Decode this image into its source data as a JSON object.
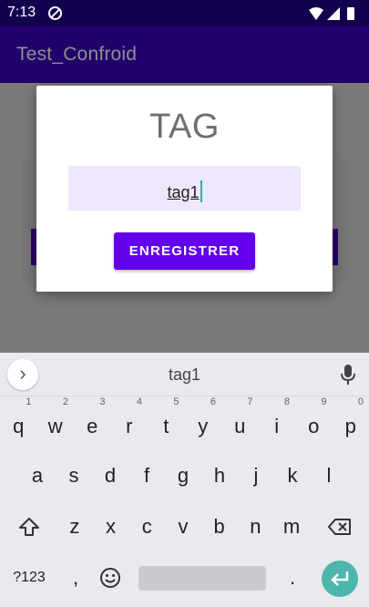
{
  "status_bar": {
    "time": "7:13"
  },
  "app_bar": {
    "title": "Test_Confroid"
  },
  "dialog": {
    "title": "TAG",
    "tag_value": "tag1",
    "save_label": "ENREGISTRER"
  },
  "keyboard": {
    "suggestion": "tag1",
    "row1": [
      {
        "k": "q",
        "h": "1"
      },
      {
        "k": "w",
        "h": "2"
      },
      {
        "k": "e",
        "h": "3"
      },
      {
        "k": "r",
        "h": "4"
      },
      {
        "k": "t",
        "h": "5"
      },
      {
        "k": "y",
        "h": "6"
      },
      {
        "k": "u",
        "h": "7"
      },
      {
        "k": "i",
        "h": "8"
      },
      {
        "k": "o",
        "h": "9"
      },
      {
        "k": "p",
        "h": "0"
      }
    ],
    "row2": [
      "a",
      "s",
      "d",
      "f",
      "g",
      "h",
      "j",
      "k",
      "l"
    ],
    "row3": [
      "z",
      "x",
      "c",
      "v",
      "b",
      "n",
      "m"
    ],
    "symbols_label": "?123",
    "comma_label": ",",
    "period_label": "."
  },
  "colors": {
    "status_bar": "#12004f",
    "app_bar": "#22006a",
    "button": "#6200ee",
    "field_bg": "#efe7fb",
    "enter_key": "#4db6ac"
  }
}
